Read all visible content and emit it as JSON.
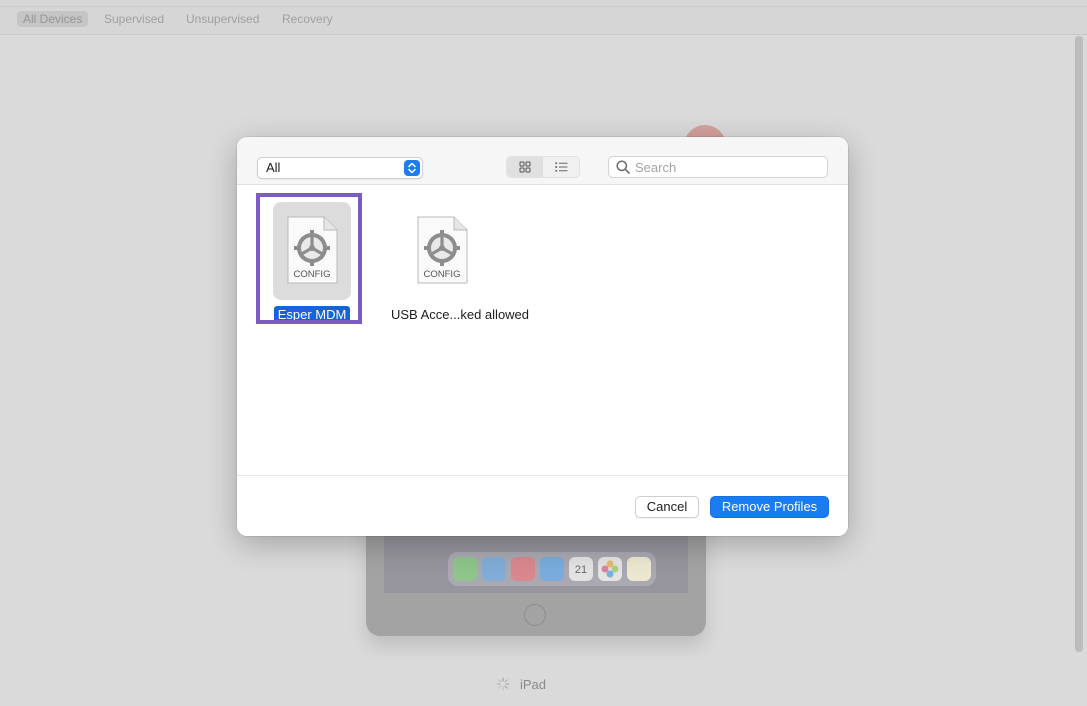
{
  "scope_bar": {
    "items": [
      "All Devices",
      "Supervised",
      "Unsupervised",
      "Recovery"
    ],
    "active_index": 0
  },
  "device": {
    "name": "iPad",
    "dock_date": "21"
  },
  "dialog": {
    "filter_popup": {
      "selected": "All"
    },
    "view_modes": [
      "grid-view",
      "list-view"
    ],
    "active_view": "grid-view",
    "search": {
      "placeholder": "Search",
      "value": ""
    },
    "profiles": [
      {
        "name": "Esper MDM",
        "icon_text": "CONFIG",
        "selected": true
      },
      {
        "name": "USB Acce...ked allowed",
        "icon_text": "CONFIG",
        "selected": false
      }
    ],
    "footer": {
      "cancel_label": "Cancel",
      "primary_label": "Remove Profiles"
    }
  },
  "colors": {
    "accent": "#1a7cf3",
    "selection": "#1565d8",
    "highlight_border": "#7b5cc4"
  }
}
